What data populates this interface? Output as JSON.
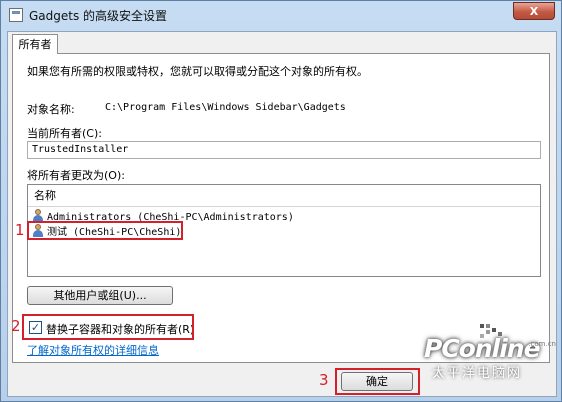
{
  "window": {
    "title": "Gadgets 的高级安全设置",
    "close_glyph": "X"
  },
  "tab": {
    "label": "所有者"
  },
  "description": "如果您有所需的权限或特权，您就可以取得或分配这个对象的所有权。",
  "object_name": {
    "label": "对象名称:",
    "value": "C:\\Program Files\\Windows Sidebar\\Gadgets"
  },
  "current_owner": {
    "label": "当前所有者(C):",
    "value": "TrustedInstaller"
  },
  "change_owner": {
    "label": "将所有者更改为(O):",
    "column_header": "名称",
    "items": [
      {
        "label": "Administrators (CheShi-PC\\Administrators)",
        "icon": "users-group-icon"
      },
      {
        "label": "测试 (CheShi-PC\\CheShi)",
        "icon": "user-icon"
      }
    ]
  },
  "other_users_button": "其他用户或组(U)...",
  "replace_owner_checkbox": {
    "label": "替换子容器和对象的所有者(R)",
    "checked": true,
    "check_glyph": "✓"
  },
  "learn_more_link": "了解对象所有权的详细信息",
  "ok_button": "确定",
  "annotations": {
    "step1": "1",
    "step2": "2",
    "step3": "3",
    "color": "#d4202a"
  },
  "watermark": {
    "logo": "PConline",
    "domain": ".com.cn",
    "tagline": "太平洋电脑网"
  }
}
